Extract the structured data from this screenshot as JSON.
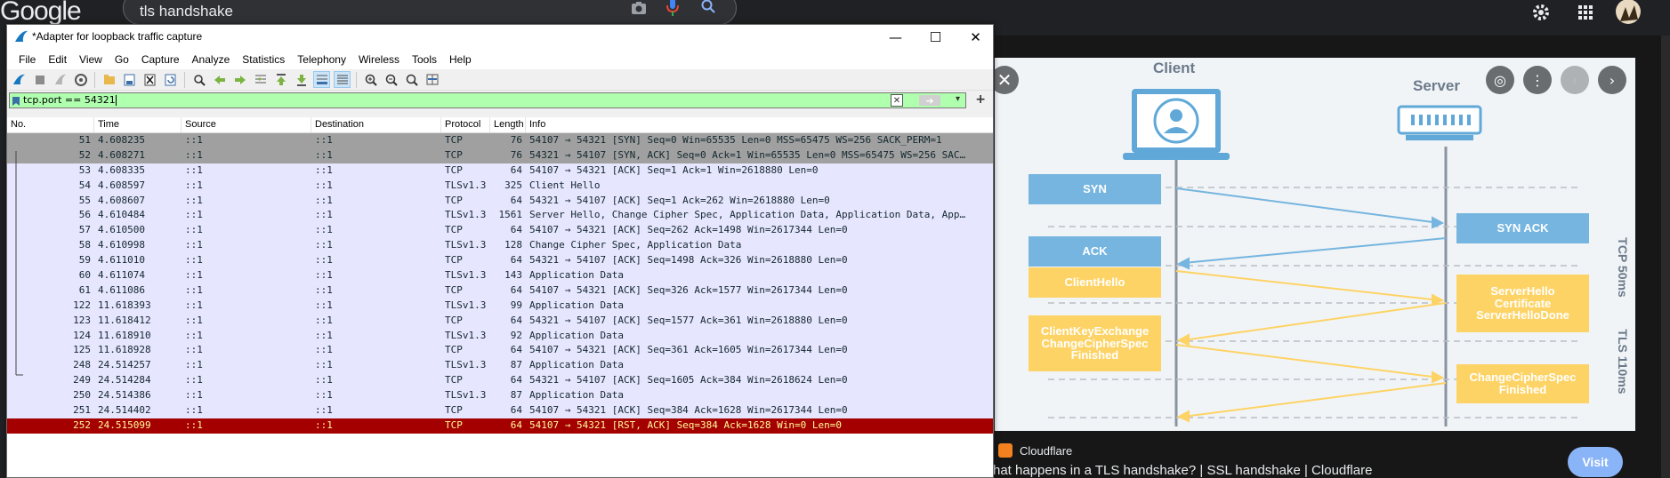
{
  "google": {
    "logo": "Google",
    "search_query": "tls handshake",
    "source_name": "Cloudflare",
    "result_title": "hat happens in a TLS handshake? | SSL handshake | Cloudflare",
    "visit_label": "Visit",
    "icons": [
      "camera-icon",
      "mic-icon",
      "search-icon",
      "gear-icon",
      "apps-grid-icon",
      "avatar"
    ],
    "diagram": {
      "client_title": "Client",
      "server_title": "Server",
      "client_msgs": [
        "SYN",
        "ACK",
        "ClientHello",
        "ClientKeyExchange ChangeCipherSpec Finished"
      ],
      "server_msgs": [
        "SYN ACK",
        "ServerHello Certificate ServerHelloDone",
        "ChangeCipherSpec Finished"
      ],
      "tcp_side": "TCP 50ms",
      "tls_side": "TLS 110ms",
      "colors": {
        "blue": "#75b5df",
        "yellow": "#fdd365",
        "background": "#f1f4f7"
      }
    }
  },
  "wireshark": {
    "title": "*Adapter for loopback traffic capture",
    "menus": [
      "File",
      "Edit",
      "View",
      "Go",
      "Capture",
      "Analyze",
      "Statistics",
      "Telephony",
      "Wireless",
      "Tools",
      "Help"
    ],
    "filter": "tcp.port == 54321",
    "columns": [
      "No.",
      "Time",
      "Source",
      "Destination",
      "Protocol",
      "Length",
      "Info"
    ],
    "colors": {
      "syn_row": "#a0a0a0",
      "normal_row": "#e7e6ff",
      "rst_row": "#a40000",
      "filter_ok": "#afffaf"
    },
    "packets": [
      {
        "no": "51",
        "time": "4.608235",
        "src": "::1",
        "dst": "::1",
        "proto": "TCP",
        "len": "76",
        "info": "54107 → 54321 [SYN] Seq=0 Win=65535 Len=0 MSS=65475 WS=256 SACK_PERM=1",
        "kind": "syn"
      },
      {
        "no": "52",
        "time": "4.608271",
        "src": "::1",
        "dst": "::1",
        "proto": "TCP",
        "len": "76",
        "info": "54321 → 54107 [SYN, ACK] Seq=0 Ack=1 Win=65535 Len=0 MSS=65475 WS=256 SAC…",
        "kind": "syn"
      },
      {
        "no": "53",
        "time": "4.608335",
        "src": "::1",
        "dst": "::1",
        "proto": "TCP",
        "len": "64",
        "info": "54107 → 54321 [ACK] Seq=1 Ack=1 Win=2618880 Len=0",
        "kind": "normal"
      },
      {
        "no": "54",
        "time": "4.608597",
        "src": "::1",
        "dst": "::1",
        "proto": "TLSv1.3",
        "len": "325",
        "info": "Client Hello",
        "kind": "normal"
      },
      {
        "no": "55",
        "time": "4.608607",
        "src": "::1",
        "dst": "::1",
        "proto": "TCP",
        "len": "64",
        "info": "54321 → 54107 [ACK] Seq=1 Ack=262 Win=2618880 Len=0",
        "kind": "normal"
      },
      {
        "no": "56",
        "time": "4.610484",
        "src": "::1",
        "dst": "::1",
        "proto": "TLSv1.3",
        "len": "1561",
        "info": "Server Hello, Change Cipher Spec, Application Data, Application Data, App…",
        "kind": "normal"
      },
      {
        "no": "57",
        "time": "4.610500",
        "src": "::1",
        "dst": "::1",
        "proto": "TCP",
        "len": "64",
        "info": "54107 → 54321 [ACK] Seq=262 Ack=1498 Win=2617344 Len=0",
        "kind": "normal"
      },
      {
        "no": "58",
        "time": "4.610998",
        "src": "::1",
        "dst": "::1",
        "proto": "TLSv1.3",
        "len": "128",
        "info": "Change Cipher Spec, Application Data",
        "kind": "normal"
      },
      {
        "no": "59",
        "time": "4.611010",
        "src": "::1",
        "dst": "::1",
        "proto": "TCP",
        "len": "64",
        "info": "54321 → 54107 [ACK] Seq=1498 Ack=326 Win=2618880 Len=0",
        "kind": "normal"
      },
      {
        "no": "60",
        "time": "4.611074",
        "src": "::1",
        "dst": "::1",
        "proto": "TLSv1.3",
        "len": "143",
        "info": "Application Data",
        "kind": "normal"
      },
      {
        "no": "61",
        "time": "4.611086",
        "src": "::1",
        "dst": "::1",
        "proto": "TCP",
        "len": "64",
        "info": "54107 → 54321 [ACK] Seq=326 Ack=1577 Win=2617344 Len=0",
        "kind": "normal"
      },
      {
        "no": "122",
        "time": "11.618393",
        "src": "::1",
        "dst": "::1",
        "proto": "TLSv1.3",
        "len": "99",
        "info": "Application Data",
        "kind": "normal"
      },
      {
        "no": "123",
        "time": "11.618412",
        "src": "::1",
        "dst": "::1",
        "proto": "TCP",
        "len": "64",
        "info": "54321 → 54107 [ACK] Seq=1577 Ack=361 Win=2618880 Len=0",
        "kind": "normal"
      },
      {
        "no": "124",
        "time": "11.618910",
        "src": "::1",
        "dst": "::1",
        "proto": "TLSv1.3",
        "len": "92",
        "info": "Application Data",
        "kind": "normal"
      },
      {
        "no": "125",
        "time": "11.618928",
        "src": "::1",
        "dst": "::1",
        "proto": "TCP",
        "len": "64",
        "info": "54107 → 54321 [ACK] Seq=361 Ack=1605 Win=2617344 Len=0",
        "kind": "normal"
      },
      {
        "no": "248",
        "time": "24.514257",
        "src": "::1",
        "dst": "::1",
        "proto": "TLSv1.3",
        "len": "87",
        "info": "Application Data",
        "kind": "normal"
      },
      {
        "no": "249",
        "time": "24.514284",
        "src": "::1",
        "dst": "::1",
        "proto": "TCP",
        "len": "64",
        "info": "54321 → 54107 [ACK] Seq=1605 Ack=384 Win=2618624 Len=0",
        "kind": "normal"
      },
      {
        "no": "250",
        "time": "24.514386",
        "src": "::1",
        "dst": "::1",
        "proto": "TLSv1.3",
        "len": "87",
        "info": "Application Data",
        "kind": "normal"
      },
      {
        "no": "251",
        "time": "24.514402",
        "src": "::1",
        "dst": "::1",
        "proto": "TCP",
        "len": "64",
        "info": "54107 → 54321 [ACK] Seq=384 Ack=1628 Win=2617344 Len=0",
        "kind": "normal"
      },
      {
        "no": "252",
        "time": "24.515099",
        "src": "::1",
        "dst": "::1",
        "proto": "TCP",
        "len": "64",
        "info": "54107 → 54321 [RST, ACK] Seq=384 Ack=1628 Win=0 Len=0",
        "kind": "rst"
      }
    ]
  }
}
